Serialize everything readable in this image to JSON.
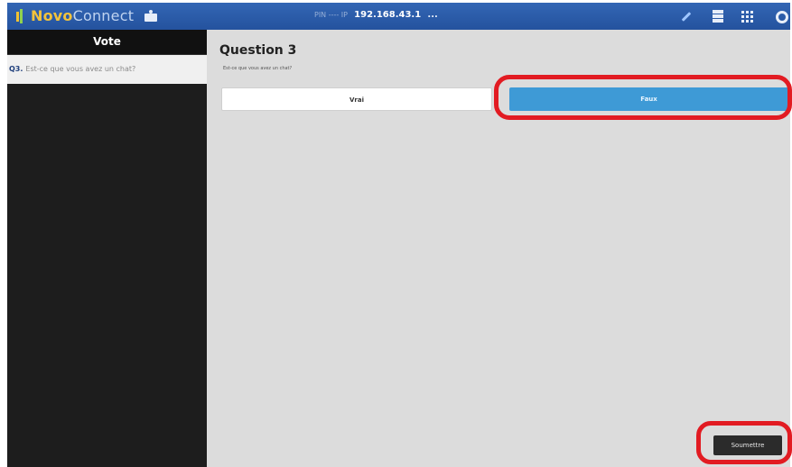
{
  "topbar": {
    "brand_novo": "Novo",
    "brand_connect": "Connect",
    "pin_label": "PIN ---- IP",
    "ip_address": "192.168.43.1",
    "more_indicator": "...",
    "background_color": "#24529e",
    "icons": [
      "presenter-icon",
      "pen-icon",
      "tray-icon",
      "grid-icon",
      "gear-icon"
    ]
  },
  "sidebar": {
    "title": "Vote",
    "items": [
      {
        "number": "Q3.",
        "label": "Est-ce que vous avez un chat?"
      }
    ]
  },
  "main": {
    "question_title": "Question 3",
    "question_text": "Est-ce que vous avez un chat?",
    "answers": [
      {
        "label": "Vrai",
        "selected": false
      },
      {
        "label": "Faux",
        "selected": true
      }
    ],
    "submit_label": "Soumettre",
    "accent_color": "#3e9ad6",
    "highlight_color": "#e21b22"
  }
}
